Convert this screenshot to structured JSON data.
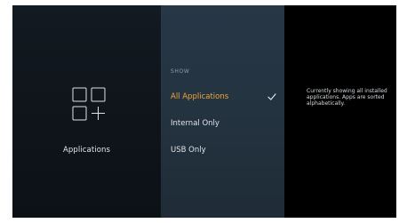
{
  "category": {
    "label": "Applications",
    "icon": "apps-grid-add-icon"
  },
  "filter": {
    "heading": "SHOW",
    "options": [
      {
        "label": "All Applications",
        "selected": true
      },
      {
        "label": "Internal Only",
        "selected": false
      },
      {
        "label": "USB Only",
        "selected": false
      }
    ],
    "check_icon": "checkmark-icon"
  },
  "description": {
    "text": "Currently showing all installed applications. Apps are sorted alphabetically."
  },
  "colors": {
    "accent_orange": "#f0a53a",
    "panel_left": "#121a22",
    "panel_middle": "#273746",
    "panel_right": "#000000",
    "text_primary": "#dfe3e7",
    "text_muted": "#8e9aa5"
  }
}
